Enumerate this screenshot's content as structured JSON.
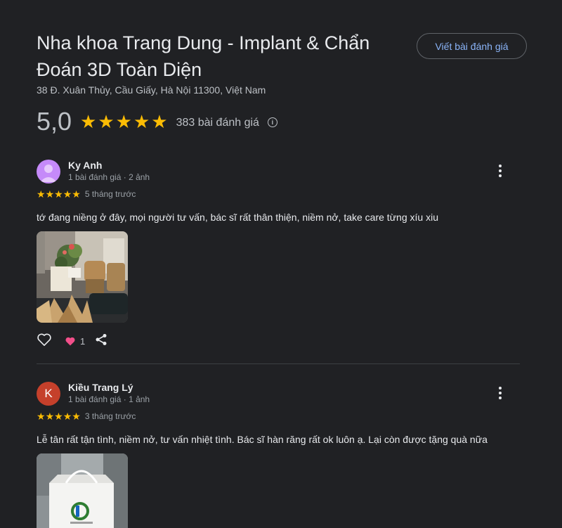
{
  "place": {
    "title": "Nha khoa Trang Dung - Implant & Chẩn Đoán 3D Toàn Diện",
    "address": "38 Đ. Xuân Thủy, Cầu Giấy, Hà Nội 11300, Việt Nam"
  },
  "write_review_label": "Viết bài đánh giá",
  "summary": {
    "rating": "5,0",
    "stars": 5,
    "review_count": "383 bài đánh giá"
  },
  "reviews": [
    {
      "name": "Ky Anh",
      "meta": "1 bài đánh giá · 2 ảnh",
      "stars": 5,
      "time": "5 tháng trước",
      "text": "tớ đang niềng ở đây, mọi người tư vấn, bác sĩ rất thân thiện, niềm nở, take care từng xíu xiu",
      "reaction_count": "1",
      "avatar_color": "#c58af9"
    },
    {
      "name": "Kiều Trang Lý",
      "avatar_letter": "K",
      "meta": "1 bài đánh giá · 1 ảnh",
      "stars": 5,
      "time": "3 tháng trước",
      "text": "Lễ tân rất tận tình, niềm nở, tư vấn nhiệt tình. Bác sĩ hàn răng rất ok luôn ạ. Lại còn được tặng quà nữa",
      "avatar_color": "#c5402b"
    }
  ],
  "colors": {
    "background": "#202124",
    "star": "#fbbc04",
    "link": "#8ab4f8",
    "heart": "#f24f8a"
  },
  "icons": [
    "star-icon",
    "info-icon",
    "more-vert-icon",
    "heart-outline-icon",
    "heart-filled-icon",
    "share-icon"
  ]
}
